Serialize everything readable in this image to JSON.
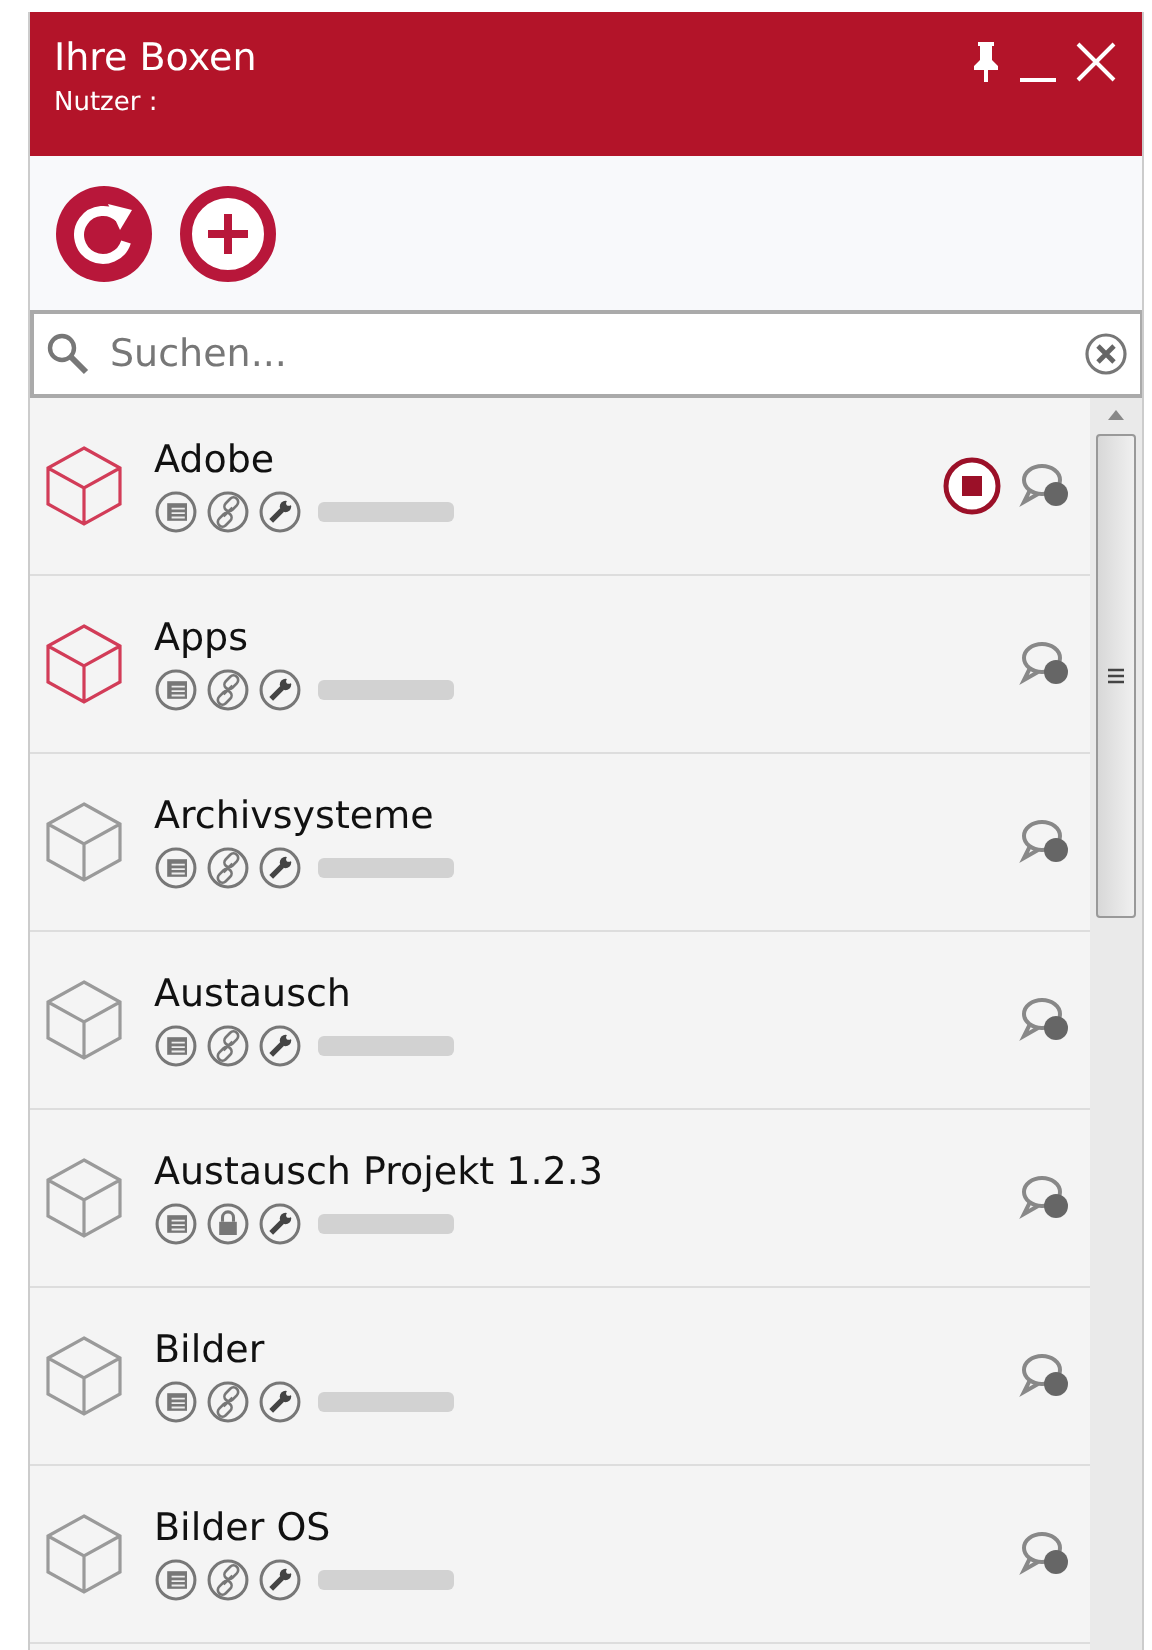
{
  "window": {
    "title": "Ihre Boxen",
    "subtitle": "Nutzer :"
  },
  "search": {
    "placeholder": "Suchen..."
  },
  "boxes": [
    {
      "name": "Adobe",
      "color": "#d23c58",
      "lock": false,
      "stop": true
    },
    {
      "name": "Apps",
      "color": "#d23c58",
      "lock": false,
      "stop": false
    },
    {
      "name": "Archivsysteme",
      "color": "#9a9a9a",
      "lock": false,
      "stop": false
    },
    {
      "name": "Austausch",
      "color": "#9a9a9a",
      "lock": false,
      "stop": false
    },
    {
      "name": "Austausch Projekt 1.2.3",
      "color": "#9a9a9a",
      "lock": true,
      "stop": false
    },
    {
      "name": "Bilder",
      "color": "#9a9a9a",
      "lock": false,
      "stop": false
    },
    {
      "name": "Bilder OS",
      "color": "#9a9a9a",
      "lock": false,
      "stop": false
    }
  ]
}
